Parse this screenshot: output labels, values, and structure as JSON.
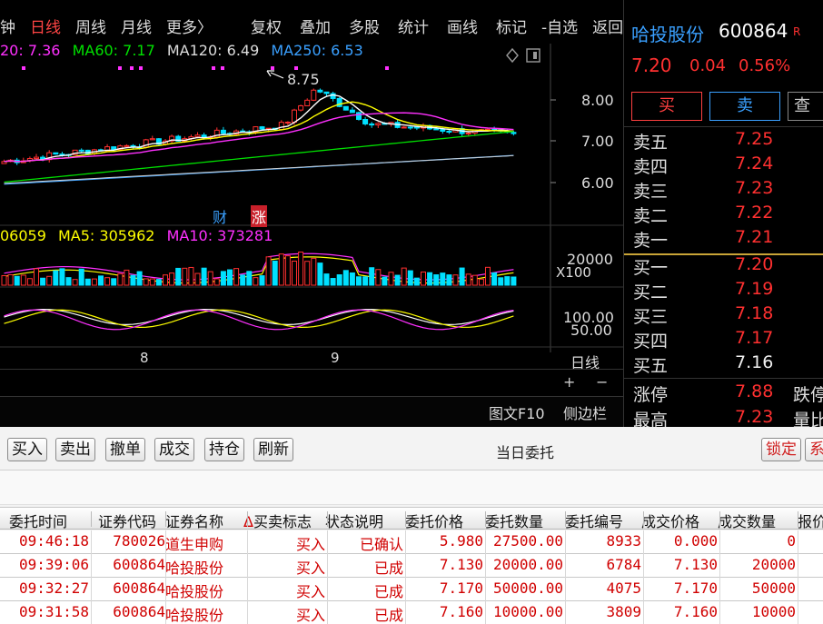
{
  "menu": {
    "items": [
      {
        "label": "钟",
        "active": false
      },
      {
        "label": "日线",
        "active": true
      },
      {
        "label": "周线",
        "active": false
      },
      {
        "label": "月线",
        "active": false
      },
      {
        "label": "更多〉",
        "active": false
      }
    ],
    "tools": [
      "复权",
      "叠加",
      "多股",
      "统计",
      "画线",
      "标记",
      "-自选",
      "返回"
    ]
  },
  "ma": {
    "ma20": "20: 7.36",
    "ma60": "MA60: 7.17",
    "ma120": "MA120: 6.49",
    "ma250": "MA250: 6.53"
  },
  "colors": {
    "ma20": "#ffffff",
    "ma_yellow": "#ffff00",
    "ma60": "#00e000",
    "ma120": "#ffffff",
    "ma250": "#3aa0ff",
    "magenta": "#ff30ff",
    "up": "#ff3030",
    "down": "#00e0ff"
  },
  "chart": {
    "high_label": "8.75",
    "price_ticks": [
      "8.00",
      "7.00",
      "6.00"
    ],
    "badges": {
      "cai": "财",
      "zhang": "涨"
    },
    "volume": {
      "prefix": "06059",
      "ma5": "MA5: 305962",
      "ma10": "MA10: 373281",
      "tick": "20000",
      "unit": "X100"
    },
    "osc_ticks": [
      "100.00",
      "50.00"
    ],
    "x_ticks": [
      "8",
      "9"
    ],
    "period": "日线",
    "zoom_in": "+",
    "zoom_out": "−",
    "f10": "图文F10",
    "sidebar": "侧边栏"
  },
  "quote": {
    "name": "哈投股份",
    "code": "600864",
    "flag": "R",
    "price": "7.20",
    "change": "0.04",
    "change_pct": "0.56%",
    "buy_label": "买",
    "sell_label": "卖",
    "query_label": "查",
    "asks": [
      {
        "label": "卖五",
        "price": "7.25",
        "flat": false
      },
      {
        "label": "卖四",
        "price": "7.24",
        "flat": false
      },
      {
        "label": "卖三",
        "price": "7.23",
        "flat": false
      },
      {
        "label": "卖二",
        "price": "7.22",
        "flat": false
      },
      {
        "label": "卖一",
        "price": "7.21",
        "flat": false
      }
    ],
    "bids": [
      {
        "label": "买一",
        "price": "7.20",
        "flat": false
      },
      {
        "label": "买二",
        "price": "7.19",
        "flat": false
      },
      {
        "label": "买三",
        "price": "7.18",
        "flat": false
      },
      {
        "label": "买四",
        "price": "7.17",
        "flat": false
      },
      {
        "label": "买五",
        "price": "7.16",
        "flat": true
      }
    ],
    "limit_up_label": "涨停",
    "limit_up": "7.88",
    "limit_down_label": "跌停",
    "high_label": "最高",
    "high": "7.23",
    "ratio_label": "量比"
  },
  "orders": {
    "toolbar": [
      "买入",
      "卖出",
      "撤单",
      "成交",
      "持仓",
      "刷新"
    ],
    "title": "当日委托",
    "lock": "锁定",
    "sys": "系",
    "columns": [
      "委托时间",
      "证券代码",
      "证券名称",
      "买卖标志",
      "状态说明",
      "委托价格",
      "委托数量",
      "委托编号",
      "成交价格",
      "成交数量",
      "报价"
    ],
    "sort_mark": "Δ",
    "rows": [
      {
        "time": "09:46:18",
        "code": "780026",
        "name": "道生申购",
        "side": "买入",
        "status": "已确认",
        "price": "5.980",
        "qty": "27500.00",
        "id": "8933",
        "deal_price": "0.000",
        "deal_qty": "0"
      },
      {
        "time": "09:39:06",
        "code": "600864",
        "name": "哈投股份",
        "side": "买入",
        "status": "已成",
        "price": "7.130",
        "qty": "20000.00",
        "id": "6784",
        "deal_price": "7.130",
        "deal_qty": "20000"
      },
      {
        "time": "09:32:27",
        "code": "600864",
        "name": "哈投股份",
        "side": "买入",
        "status": "已成",
        "price": "7.170",
        "qty": "50000.00",
        "id": "4075",
        "deal_price": "7.170",
        "deal_qty": "50000"
      },
      {
        "time": "09:31:58",
        "code": "600864",
        "name": "哈投股份",
        "side": "买入",
        "status": "已成",
        "price": "7.160",
        "qty": "10000.00",
        "id": "3809",
        "deal_price": "7.160",
        "deal_qty": "10000"
      }
    ]
  }
}
